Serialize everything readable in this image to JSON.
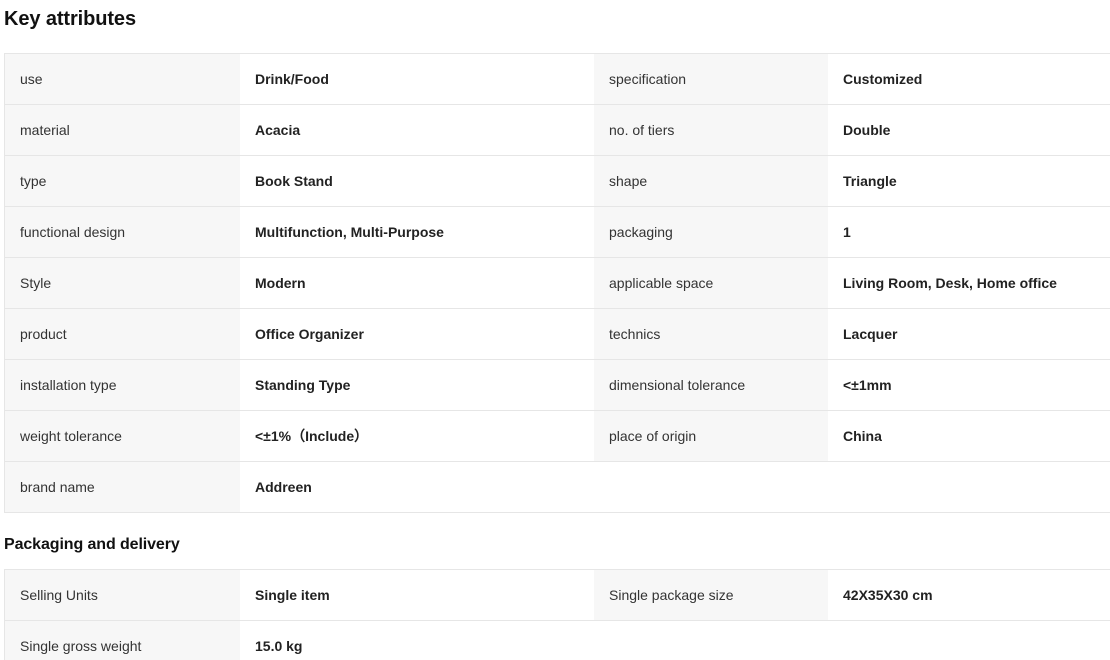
{
  "key_attributes": {
    "title": "Key attributes",
    "rows": [
      {
        "l1": "use",
        "v1": "Drink/Food",
        "l2": "specification",
        "v2": "Customized"
      },
      {
        "l1": "material",
        "v1": "Acacia",
        "l2": "no. of tiers",
        "v2": "Double"
      },
      {
        "l1": "type",
        "v1": "Book Stand",
        "l2": "shape",
        "v2": "Triangle"
      },
      {
        "l1": "functional design",
        "v1": "Multifunction, Multi-Purpose",
        "l2": "packaging",
        "v2": "1"
      },
      {
        "l1": "Style",
        "v1": "Modern",
        "l2": "applicable space",
        "v2": "Living Room, Desk, Home office"
      },
      {
        "l1": "product",
        "v1": "Office Organizer",
        "l2": "technics",
        "v2": "Lacquer"
      },
      {
        "l1": "installation type",
        "v1": "Standing Type",
        "l2": "dimensional tolerance",
        "v2": "<±1mm"
      },
      {
        "l1": "weight tolerance",
        "v1": "<±1%（Include）",
        "l2": "place of origin",
        "v2": "China"
      },
      {
        "l1": "brand name",
        "v1": "Addreen"
      }
    ]
  },
  "packaging_delivery": {
    "title": "Packaging and delivery",
    "rows": [
      {
        "l1": "Selling Units",
        "v1": "Single item",
        "l2": "Single package size",
        "v2": "42X35X30 cm"
      },
      {
        "l1": "Single gross weight",
        "v1": "15.0 kg"
      }
    ]
  }
}
